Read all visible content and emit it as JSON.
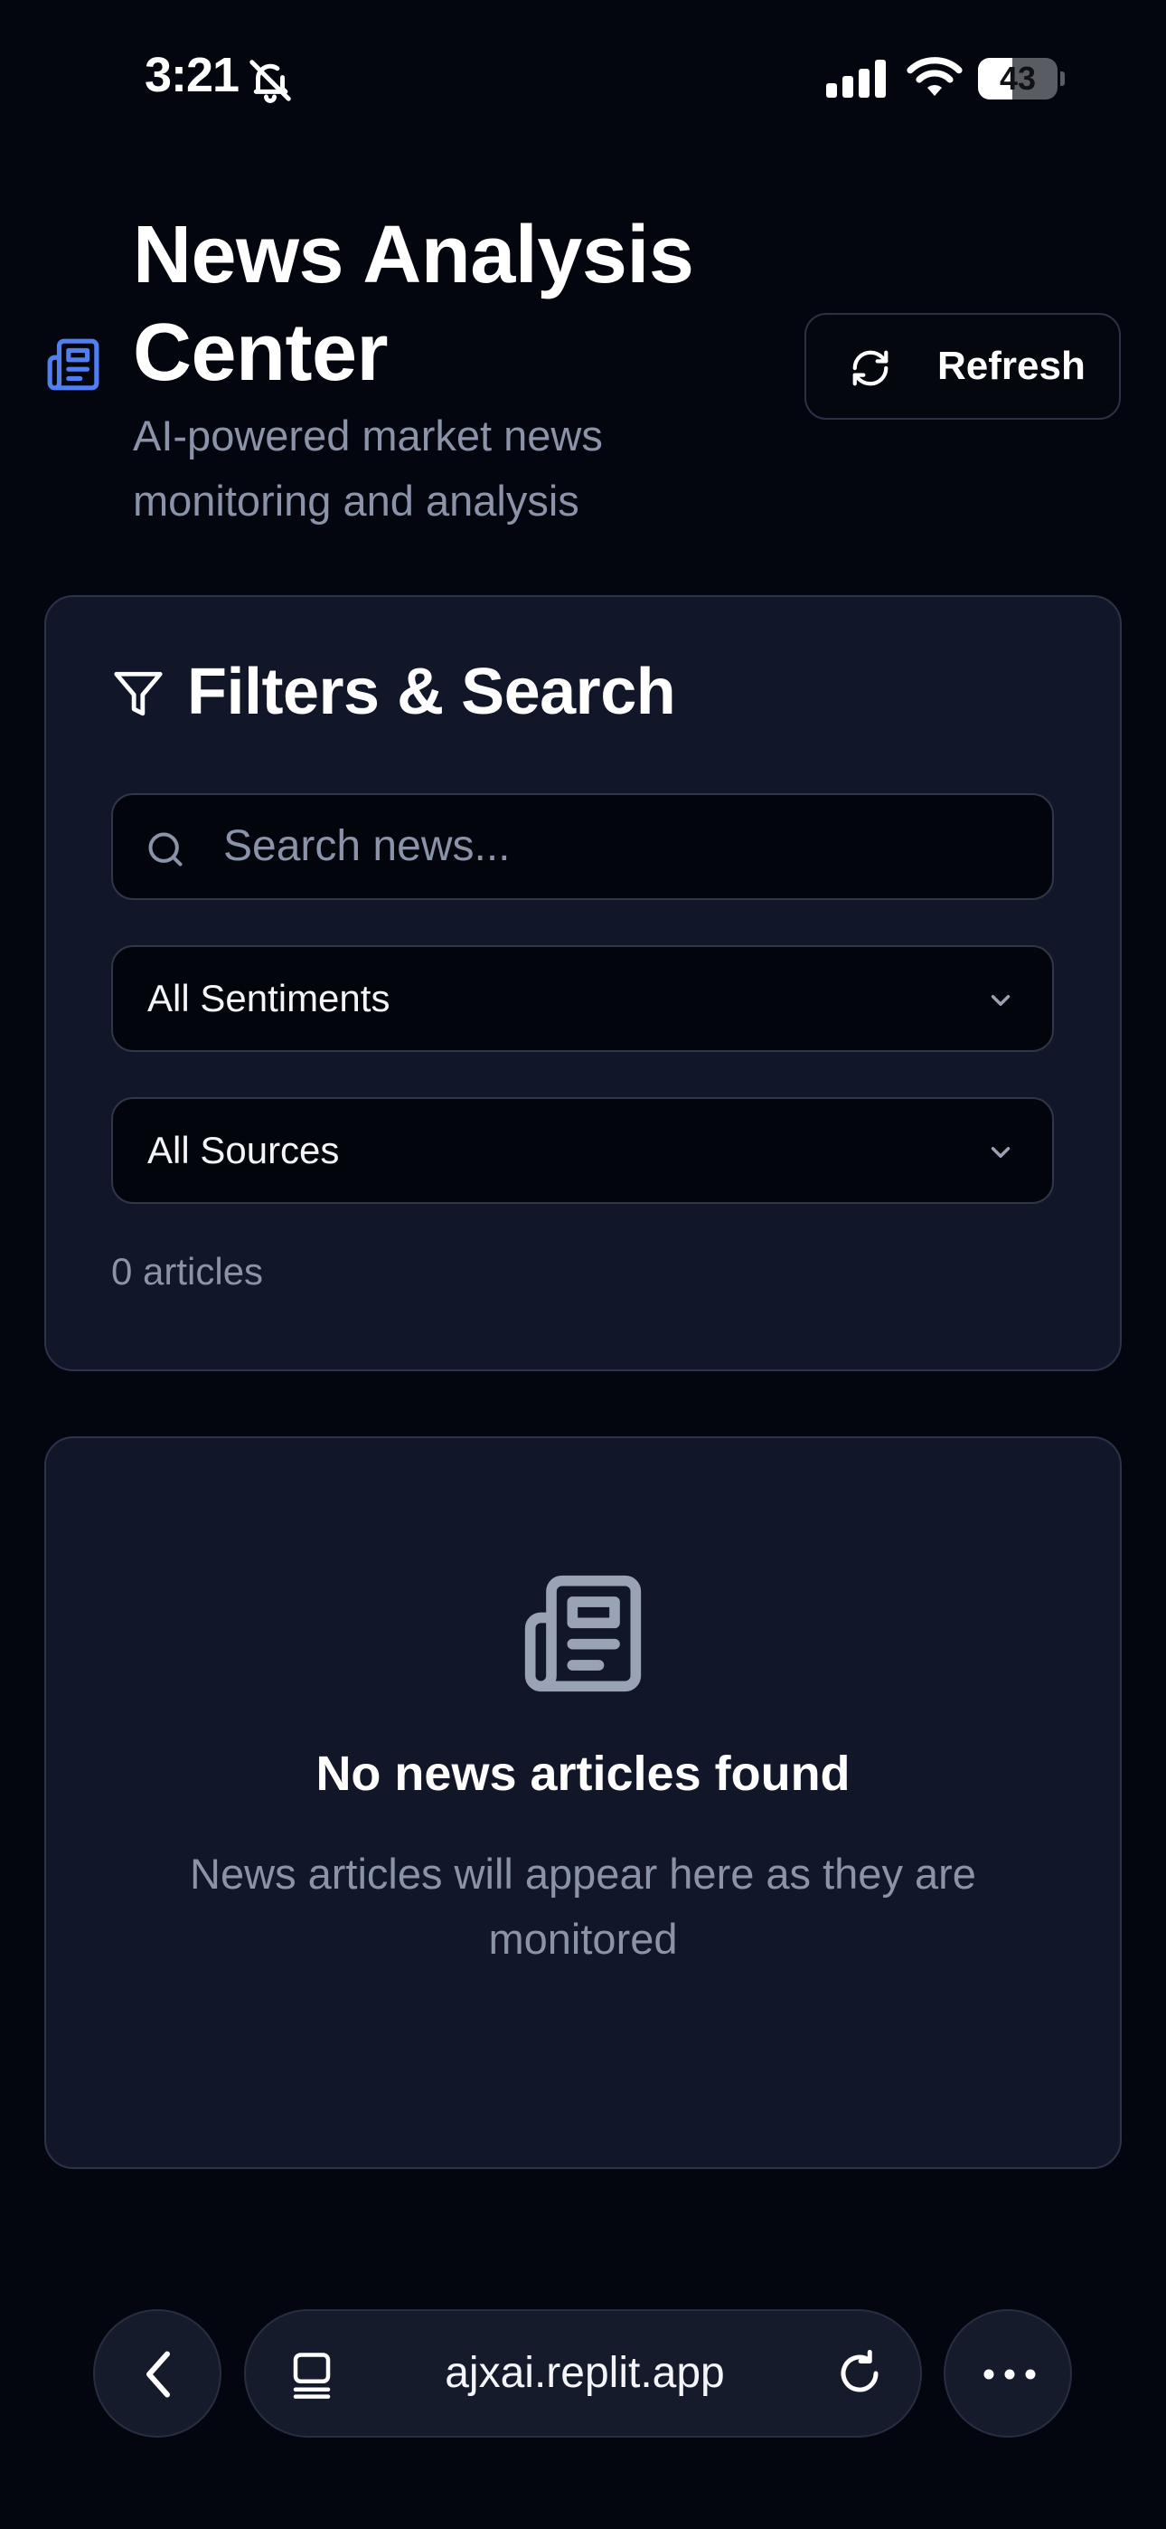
{
  "status_bar": {
    "time": "3:21",
    "battery_level": "43",
    "battery_fraction": 0.43
  },
  "header": {
    "title": "News Analysis Center",
    "subtitle": "AI-powered market news monitoring and analysis",
    "refresh_label": "Refresh"
  },
  "filters": {
    "title": "Filters & Search",
    "search_placeholder": "Search news...",
    "sentiment_value": "All Sentiments",
    "source_value": "All Sources",
    "article_count": "0 articles"
  },
  "empty_state": {
    "title": "No news articles found",
    "description": "News articles will appear here as they are monitored"
  },
  "browser": {
    "url": "ajxai.replit.app"
  },
  "colors": {
    "background": "#04060f",
    "card": "#111628",
    "accent": "#4f7ff0",
    "muted_text": "#8a93a7"
  },
  "icons": [
    "bell-slash-icon",
    "signal-icon",
    "wifi-icon",
    "newspaper-icon",
    "refresh-icon",
    "filter-icon",
    "search-icon",
    "chevron-down-icon",
    "back-icon",
    "tab-icon",
    "reload-icon",
    "more-icon"
  ]
}
